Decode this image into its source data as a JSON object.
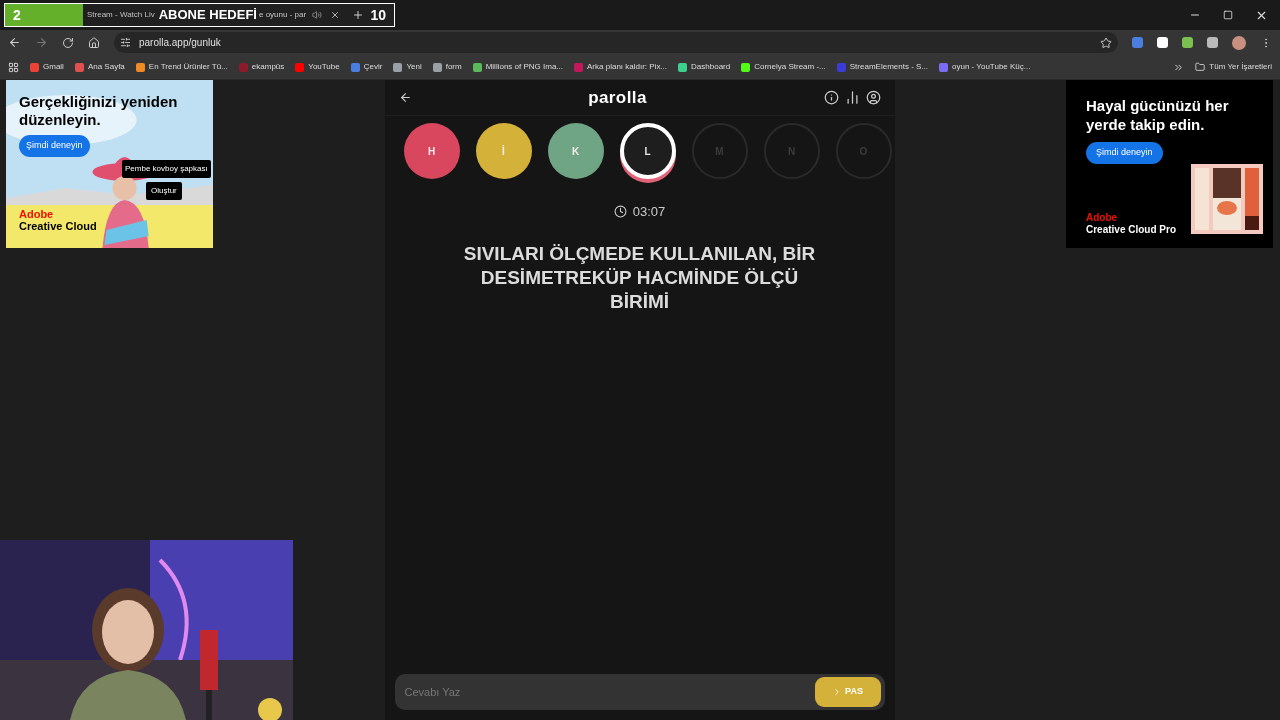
{
  "stream_overlay": {
    "goal_current": "2",
    "goal_label": "ABONE HEDEFİ",
    "goal_target": "10",
    "level": 0.2
  },
  "tabs": [
    {
      "title": "Stream - Watch Liv",
      "selected": false
    },
    {
      "title": "e oyunu - par",
      "selected": true
    }
  ],
  "address_bar": {
    "url": "parolla.app/gunluk"
  },
  "bookmarks": [
    {
      "label": "Gmail",
      "color": "#ea4335"
    },
    {
      "label": "Ana Sayfa",
      "color": "#e05050"
    },
    {
      "label": "En Trend Ürünler Tü...",
      "color": "#f08a24"
    },
    {
      "label": "ekampüs",
      "color": "#8b1a2b"
    },
    {
      "label": "YouTube",
      "color": "#ff0000"
    },
    {
      "label": "Çevir",
      "color": "#4a7fe0"
    },
    {
      "label": "Yeni",
      "color": "#9aa0a6"
    },
    {
      "label": "form",
      "color": "#9aa0a6"
    },
    {
      "label": "Millions of PNG Ima...",
      "color": "#5cb85c"
    },
    {
      "label": "Arka planı kaldır: Pix...",
      "color": "#c2185b"
    },
    {
      "label": "Dashboard",
      "color": "#3ecf8e"
    },
    {
      "label": "Cornelya Stream -...",
      "color": "#53fc18"
    },
    {
      "label": "StreamElements - S...",
      "color": "#3b3bd6"
    },
    {
      "label": "oyun - YouTube Küç...",
      "color": "#7b6cf6"
    }
  ],
  "all_bookmarks": "Tüm Yer İşaretleri",
  "ad_left": {
    "headline": "Gerçekliğinizi yeniden düzenleyin.",
    "cta": "Şimdi deneyin",
    "chip": "Pembe kovboy şapkası",
    "chip_button": "Oluştur",
    "brand": "Adobe",
    "product": "Creative Cloud"
  },
  "ad_right": {
    "headline": "Hayal gücünüzü her yerde takip edin.",
    "cta": "Şimdi deneyin",
    "brand": "Adobe",
    "product": "Creative Cloud Pro"
  },
  "app": {
    "title": "parolla",
    "timer": "03:07",
    "question": "SIVILARI ÖLÇMEDE KULLANILAN, BİR DESİMETREKÜP HACMİNDE ÖLÇÜ BİRİMİ",
    "answer_placeholder": "Cevabı Yaz",
    "pass_button": "PAS"
  },
  "letters": [
    {
      "letter": "H",
      "kind": "answered",
      "color": "#d9475f"
    },
    {
      "letter": "İ",
      "kind": "answered",
      "color": "#d4b23a"
    },
    {
      "letter": "K",
      "kind": "answered",
      "color": "#6fa584"
    },
    {
      "letter": "L",
      "kind": "current"
    },
    {
      "letter": "M",
      "kind": "pending"
    },
    {
      "letter": "N",
      "kind": "pending"
    },
    {
      "letter": "O",
      "kind": "pending"
    }
  ]
}
